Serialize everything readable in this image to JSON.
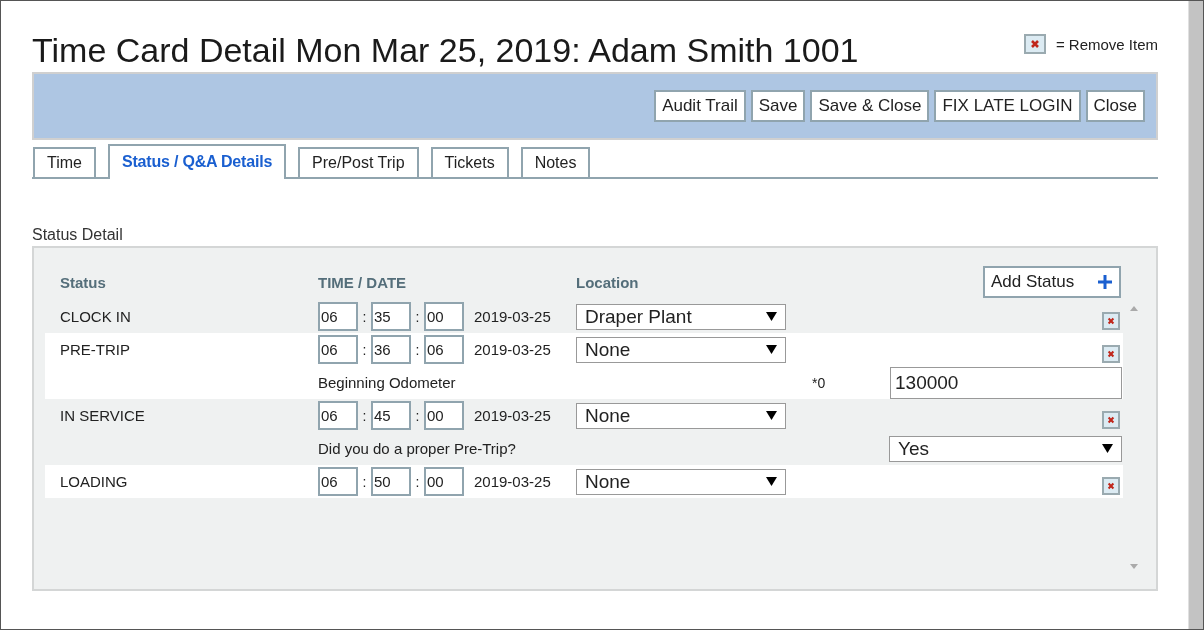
{
  "page": {
    "title": "Time Card Detail Mon Mar 25, 2019: Adam Smith 1001",
    "legend": "= Remove Item"
  },
  "toolbar": {
    "buttons": [
      "Audit Trail",
      "Save",
      "Save & Close",
      "FIX LATE LOGIN",
      "Close"
    ]
  },
  "tabs": [
    {
      "label": "Time",
      "selected": false
    },
    {
      "label": "Status / Q&A Details",
      "selected": true
    },
    {
      "label": "Pre/Post Trip",
      "selected": false
    },
    {
      "label": "Tickets",
      "selected": false
    },
    {
      "label": "Notes",
      "selected": false
    }
  ],
  "status_detail": {
    "heading": "Status Detail",
    "columns": [
      "Status",
      "TIME / DATE",
      "Location"
    ],
    "add_button": "Add Status",
    "time_separator": ":",
    "rows": [
      {
        "status": "CLOCK IN",
        "hour": "06",
        "minute": "35",
        "second": "00",
        "date": "2019-03-25",
        "location": "Draper Plant"
      },
      {
        "status": "PRE-TRIP",
        "hour": "06",
        "minute": "36",
        "second": "06",
        "date": "2019-03-25",
        "location": "None",
        "details": [
          {
            "kind": "text-input",
            "label": "Beginning Odometer",
            "note": "*0",
            "value": "130000"
          }
        ]
      },
      {
        "status": "IN SERVICE",
        "hour": "06",
        "minute": "45",
        "second": "00",
        "date": "2019-03-25",
        "location": "None",
        "details": [
          {
            "kind": "select",
            "label": "Did you do a proper Pre-Trip?",
            "value": "Yes"
          }
        ]
      },
      {
        "status": "LOADING",
        "hour": "06",
        "minute": "50",
        "second": "00",
        "date": "2019-03-25",
        "location": "None"
      }
    ]
  }
}
